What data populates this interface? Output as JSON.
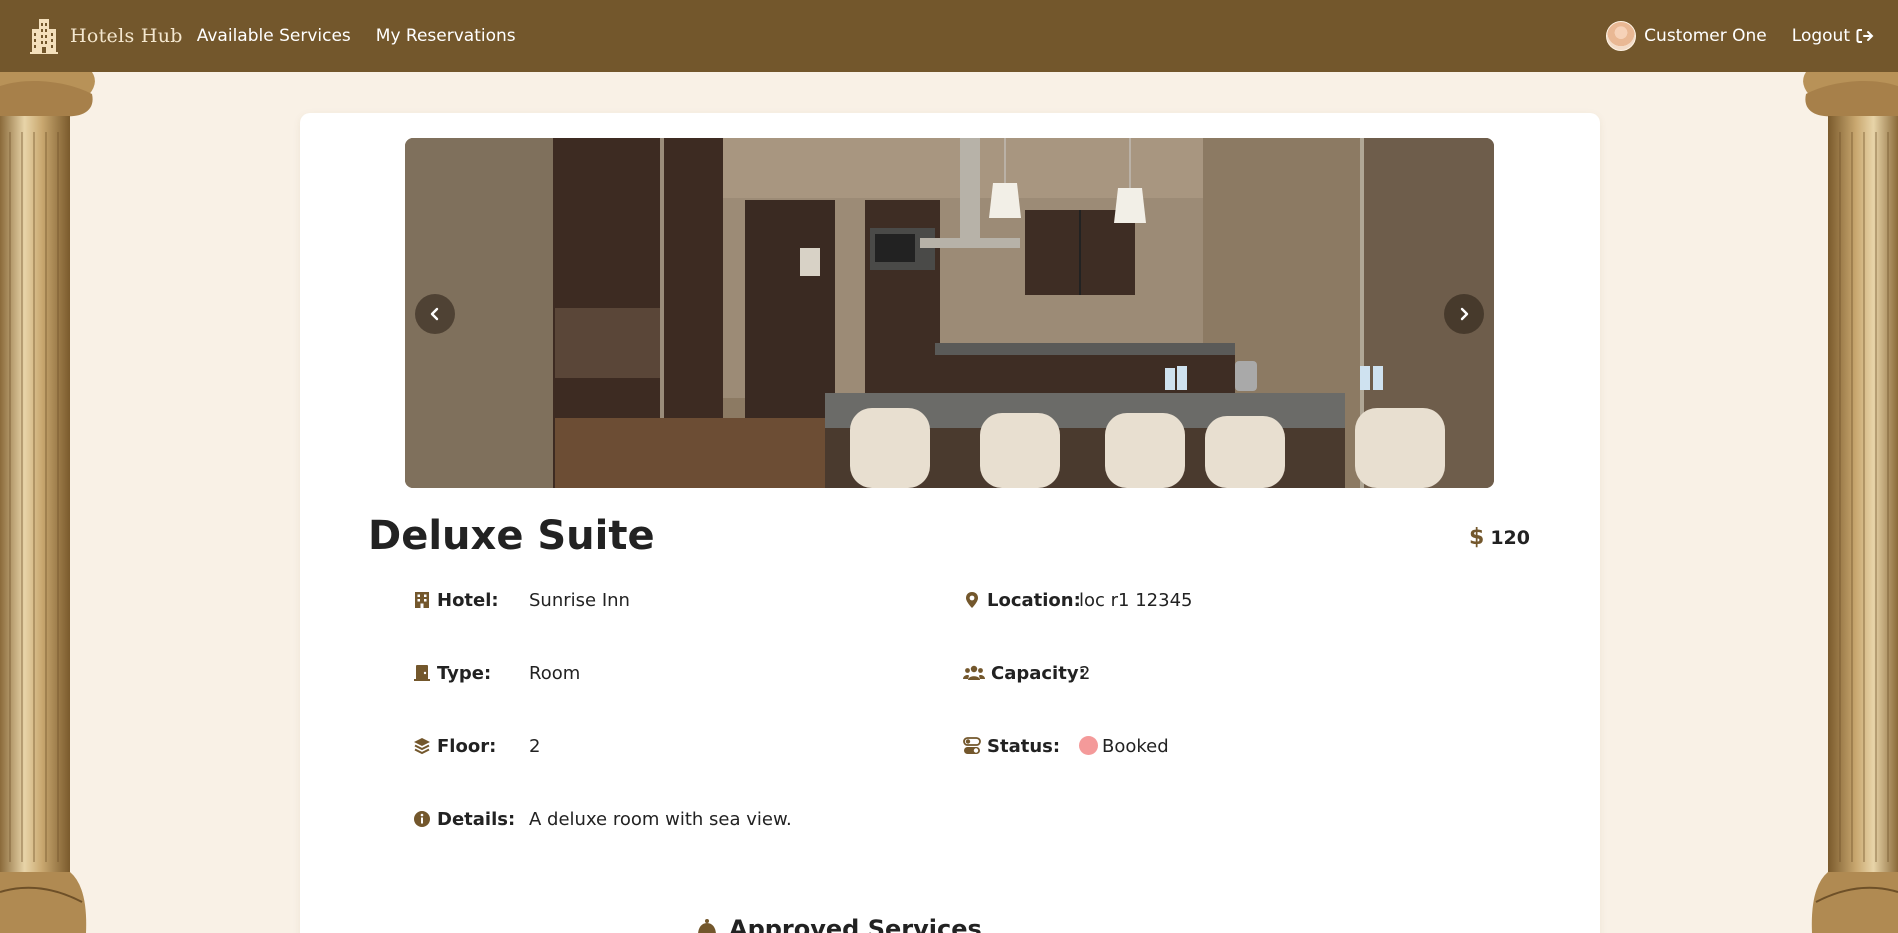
{
  "nav": {
    "brand": "Hotels Hub",
    "links": [
      "Available Services",
      "My Reservations"
    ],
    "user_name": "Customer One",
    "logout_label": "Logout"
  },
  "room": {
    "title": "Deluxe Suite",
    "price_symbol": "$",
    "price": "120",
    "fields": {
      "hotel": {
        "label": "Hotel:",
        "value": "Sunrise Inn"
      },
      "location": {
        "label": "Location:",
        "value": "loc r1 12345"
      },
      "type": {
        "label": "Type:",
        "value": "Room"
      },
      "capacity": {
        "label": "Capacity:",
        "value": "2"
      },
      "floor": {
        "label": "Floor:",
        "value": "2"
      },
      "status": {
        "label": "Status:",
        "value": "Booked",
        "color": "#f49a9a"
      },
      "details": {
        "label": "Details:",
        "value": "A deluxe room with sea view."
      }
    }
  },
  "services": {
    "heading": "Approved Services"
  },
  "icons": {
    "brand": "hotel-building-icon",
    "logout": "logout-icon",
    "hotel": "building-icon",
    "location": "map-pin-icon",
    "type": "door-icon",
    "capacity": "users-icon",
    "floor": "layers-icon",
    "status": "toggle-icon",
    "details": "info-icon",
    "services": "bell-icon",
    "prev": "chevron-left-icon",
    "next": "chevron-right-icon"
  },
  "colors": {
    "navbar": "#73572c",
    "accent": "#73572c",
    "page_bg": "#f9f1e6",
    "status_booked": "#f49a9a"
  }
}
